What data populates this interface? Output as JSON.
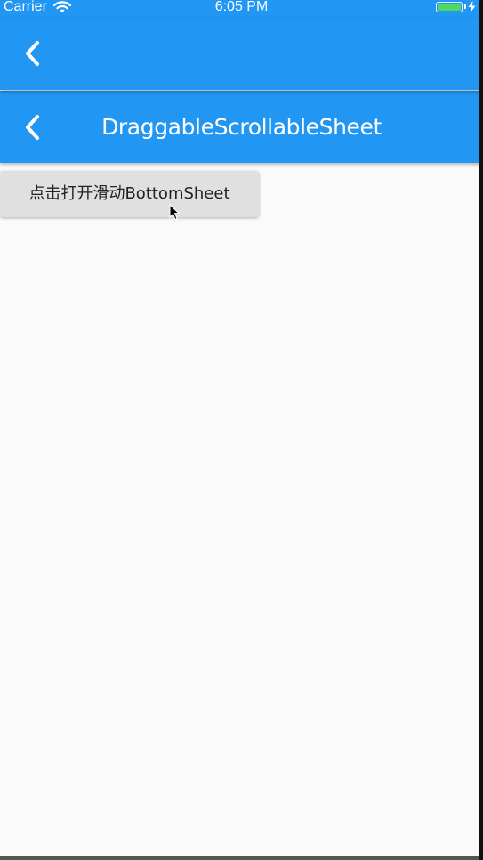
{
  "status_bar": {
    "carrier": "Carrier",
    "time": "6:05 PM",
    "icons": [
      "wifi-icon",
      "battery-icon",
      "charging-bolt-icon"
    ],
    "battery_color": "#4cd964"
  },
  "app_bar_outer": {
    "back_icon": "chevron-left-icon"
  },
  "app_bar_inner": {
    "back_icon": "chevron-left-icon",
    "title": "DraggableScrollableSheet"
  },
  "main": {
    "open_button_label": "点击打开滑动BottomSheet"
  },
  "colors": {
    "primary": "#2196f3",
    "background": "#fafafa",
    "button_bg": "#e0e0e0",
    "text_light": "#ffffff",
    "text_dark": "#222222"
  }
}
